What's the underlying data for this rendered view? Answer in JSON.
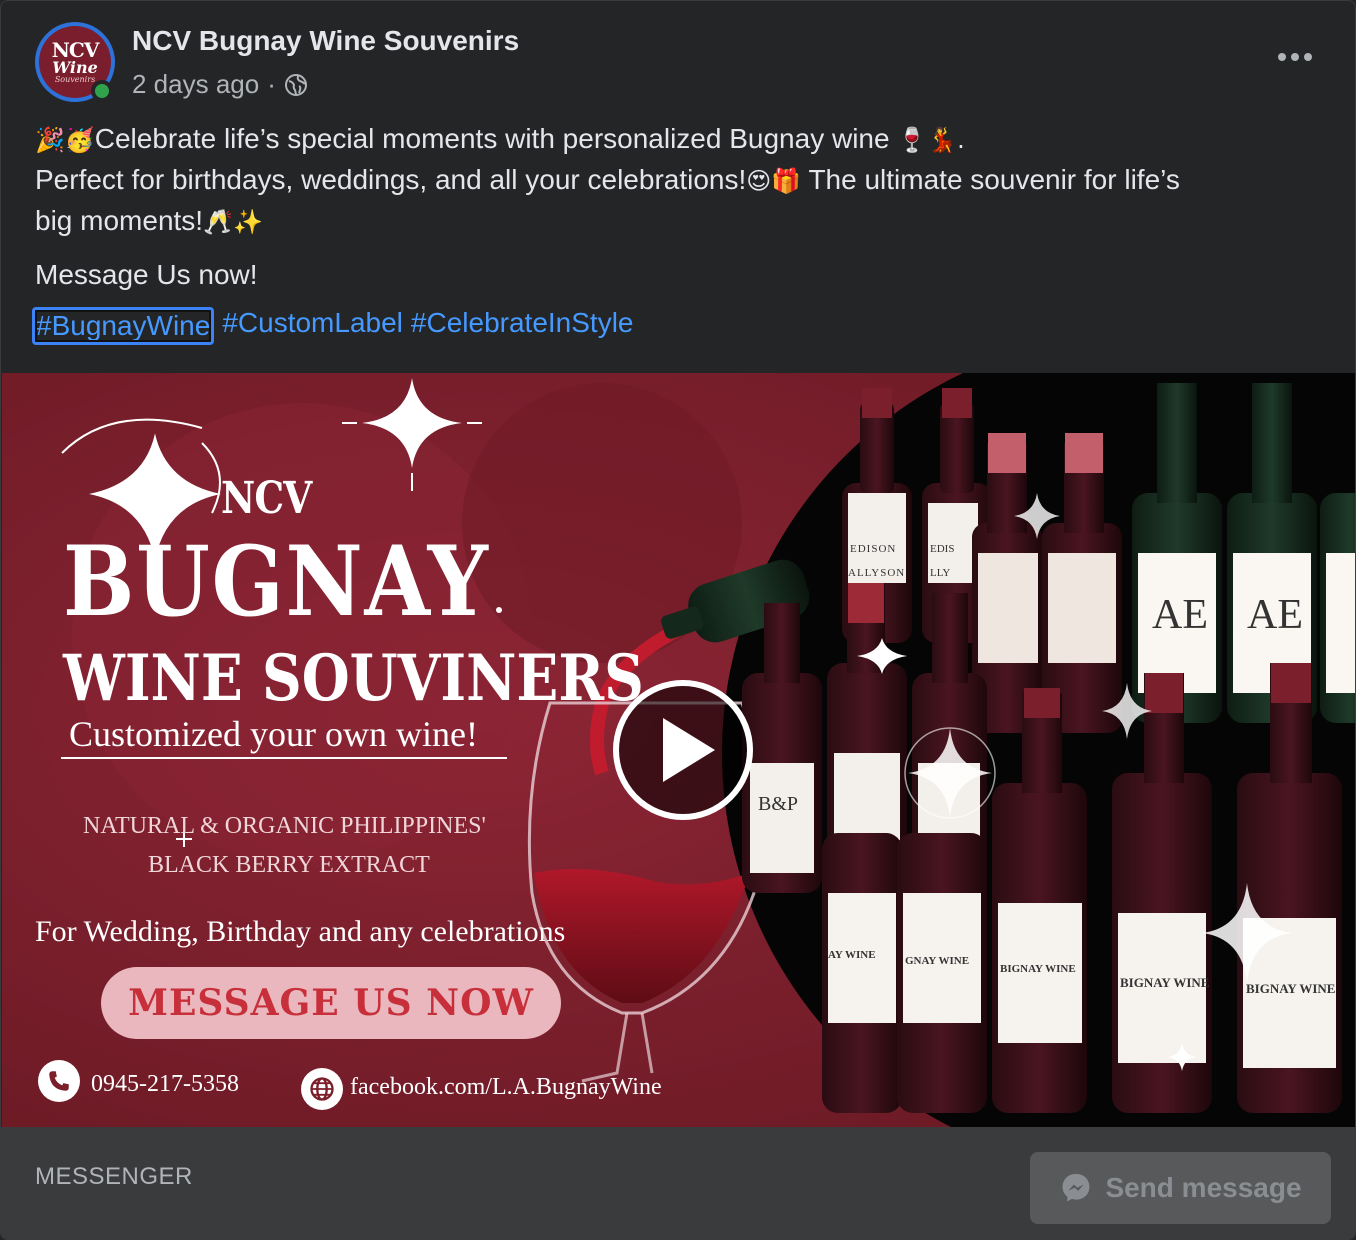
{
  "header": {
    "page_name": "NCV Bugnay Wine Souvenirs",
    "time": "2 days ago",
    "separator": "·",
    "avatar_text": [
      "NCV",
      "Wine",
      "Souvenirs"
    ]
  },
  "post": {
    "line1_emoji_lead": "🎉🥳",
    "line1_text": "Celebrate life’s special moments with personalized Bugnay wine",
    "line1_emoji_tail": "🍷💃.",
    "line2_text": "Perfect for birthdays, weddings, and all your celebrations!",
    "line2_emoji": "😍🎁",
    "line2_text_b": " The ultimate souvenir for life’s",
    "line3_text": "big moments!",
    "line3_emoji": "🥂✨",
    "cta": "Message Us now!",
    "hashtags": [
      "#BugnayWine",
      "#CustomLabel",
      "#CelebrateInStyle"
    ]
  },
  "media": {
    "ncv": "NCV",
    "bugnay": "BUGNAY",
    "souviners": "WINE SOUVINERS",
    "customized": "Customized your own wine!",
    "natural": "NATURAL & ORGANIC PHILIPPINES'",
    "berry": "BLACK BERRY EXTRACT",
    "for_line": "For Wedding, Birthday and any celebrations",
    "pill": "MESSAGE US NOW",
    "phone": "0945-217-5358",
    "website": "facebook.com/L.A.BugnayWine",
    "labels": {
      "edison": "EDISON",
      "allyson": "ALLYSON",
      "edis": "EDIS",
      "lly": "LLY",
      "ae1": "AE",
      "ae2": "AE",
      "bp": "B&P",
      "wine1": "AY WINE",
      "wine2": "GNAY WINE",
      "wine3": "BIGNAY WINE",
      "wine4": "BIGNAY WINE",
      "wine5": "BIGNAY WINE"
    }
  },
  "footer": {
    "messenger_label": "MESSENGER",
    "send_label": "Send message"
  },
  "colors": {
    "background": "#242526",
    "link": "#4599ff",
    "wine": "#7b1f2b",
    "online": "#31a24c"
  },
  "icons": [
    "globe-icon",
    "more-icon",
    "play-icon",
    "phone-icon",
    "web-icon",
    "messenger-icon"
  ]
}
